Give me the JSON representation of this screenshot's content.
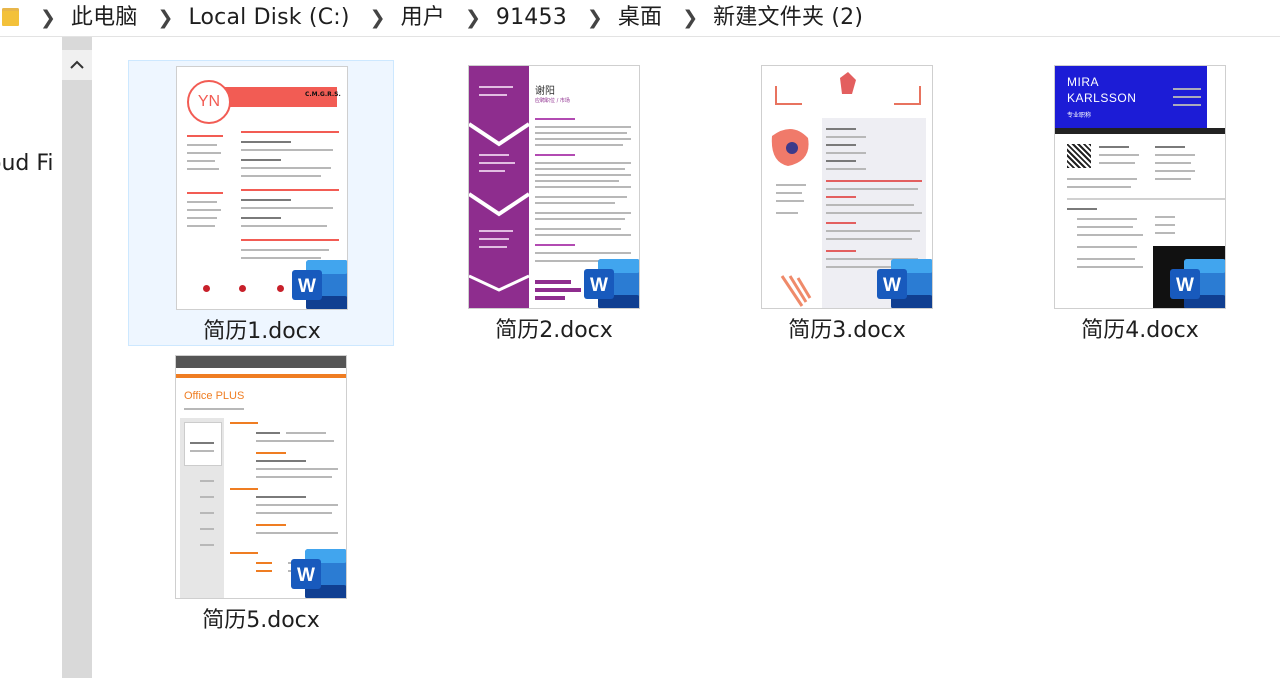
{
  "breadcrumb": [
    "此电脑",
    "Local Disk (C:)",
    "用户",
    "91453",
    "桌面",
    "新建文件夹 (2)"
  ],
  "nav": {
    "partial_label": "oud Fi"
  },
  "colors": {
    "selection_bg": "#eef6ff",
    "selection_border": "#cde8ff",
    "word_blue": "#185abd",
    "folder_yellow": "#f3c13a"
  },
  "files": [
    {
      "name": "简历1.docx",
      "selected": true,
      "thumb": {
        "initials": "YN",
        "headline": "C.M.G.R.S."
      }
    },
    {
      "name": "简历2.docx",
      "selected": false,
      "thumb": {
        "name": "谢阳",
        "sub": "应聘职位 / 市场"
      }
    },
    {
      "name": "简历3.docx",
      "selected": false,
      "thumb": {}
    },
    {
      "name": "简历4.docx",
      "selected": false,
      "thumb": {
        "name_line1": "MIRA",
        "name_line2": "KARLSSON",
        "sub": "专业职称"
      }
    },
    {
      "name": "简历5.docx",
      "selected": false,
      "thumb": {
        "brand": "Office PLUS"
      }
    }
  ],
  "icons": [
    "folder-icon",
    "chevron-right-icon",
    "scroll-up-icon",
    "word-doc-icon"
  ]
}
